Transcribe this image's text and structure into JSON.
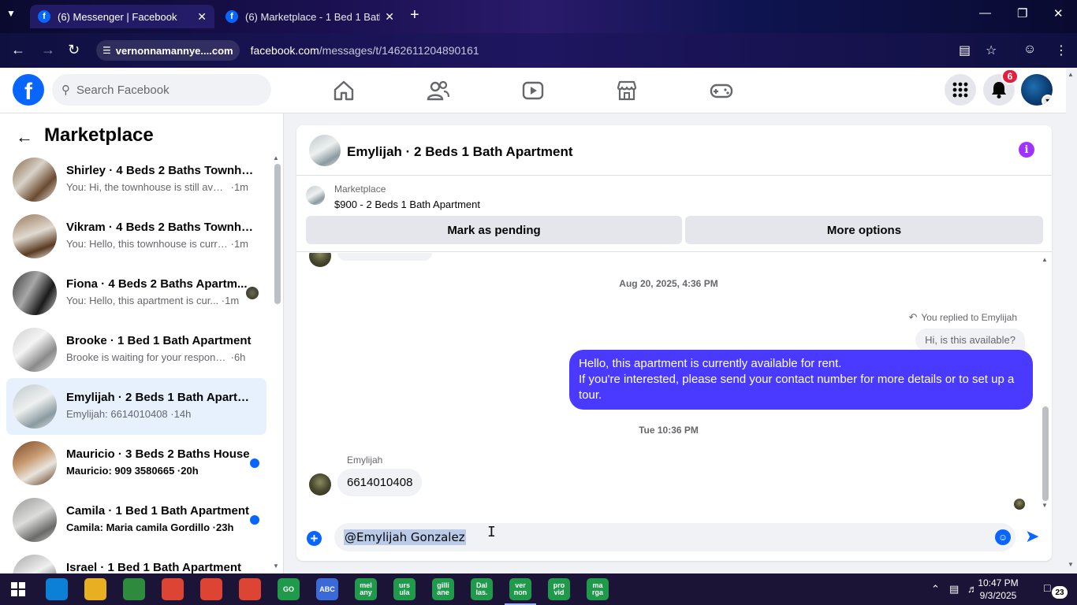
{
  "browser": {
    "tabs": [
      {
        "title": "(6) Messenger | Facebook",
        "active": true
      },
      {
        "title": "(6) Marketplace - 1 Bed 1 Bath Apartment",
        "active": false
      }
    ],
    "site_chip": "vernonnamannye....com",
    "url_host": "facebook.com",
    "url_path": "/messages/t/1462611204890161"
  },
  "fb": {
    "logo": "f",
    "search_placeholder": "Search Facebook",
    "notification_count": "6",
    "nav_icons": [
      "home-icon",
      "friends-icon",
      "video-icon",
      "marketplace-icon",
      "gaming-icon"
    ]
  },
  "sidebar": {
    "title": "Marketplace",
    "conversations": [
      {
        "name": "Shirley · 4 Beds 2 Baths Townho...",
        "snippet": "You: Hi, the townhouse is still avail...",
        "time": "1m",
        "unread": false
      },
      {
        "name": "Vikram · 4 Beds 2 Baths Townho...",
        "snippet": "You: Hello, this townhouse is curre...",
        "time": "1m",
        "unread": false
      },
      {
        "name": "Fiona · 4 Beds 2 Baths Apartm...",
        "snippet": "You: Hello, this apartment is cur...",
        "time": "1m",
        "unread": false
      },
      {
        "name": "Brooke · 1 Bed 1 Bath Apartment",
        "snippet": "Brooke is waiting for your response.",
        "time": "6h",
        "unread": false
      },
      {
        "name": "Emylijah · 2 Beds 1 Bath Apartm...",
        "snippet": "Emylijah: 6614010408",
        "time": "14h",
        "unread": false,
        "selected": true
      },
      {
        "name": "Mauricio · 3 Beds 2 Baths House",
        "snippet": "Mauricio: 909 3580665",
        "time": "20h",
        "unread": true
      },
      {
        "name": "Camila · 1 Bed 1 Bath Apartment",
        "snippet": "Camila: Maria camila Gordillo",
        "time": "23h",
        "unread": true
      },
      {
        "name": "Israel · 1 Bed 1 Bath Apartment",
        "snippet": "",
        "time": "",
        "unread": false
      }
    ]
  },
  "chat": {
    "title": "Emylijah · 2 Beds 1 Bath Apartment",
    "marketplace_label": "Marketplace",
    "listing": "$900 - 2 Beds 1 Bath Apartment",
    "mark_pending": "Mark as pending",
    "more_options": "More options",
    "timestamp_1": "Aug 20, 2025, 4:36 PM",
    "replied_label": "You replied to Emylijah",
    "quoted_text": "Hi, is this available?",
    "outgoing_line_1": "Hello, this apartment is currently available for rent.",
    "outgoing_line_2": "If you're interested, please send your contact number for more details or to set up a tour.",
    "timestamp_2": "Tue 10:36 PM",
    "sender_name": "Emylijah",
    "incoming_text": "6614010408",
    "composer_value": "@Emylijah Gonzalez"
  },
  "taskbar": {
    "apps": [
      {
        "label": "",
        "color": "#0c7fd6",
        "icon": "edge-icon"
      },
      {
        "label": "",
        "color": "#e8b020",
        "icon": "folder-icon"
      },
      {
        "label": "",
        "color": "#2e8b3e",
        "icon": "spreadsheet-icon"
      },
      {
        "label": "",
        "color": "#dd4433",
        "icon": "chrome-icon"
      },
      {
        "label": "",
        "color": "#dd4433",
        "icon": "chrome-h-icon"
      },
      {
        "label": "",
        "color": "#dd4433",
        "icon": "chrome-m-icon"
      },
      {
        "label": "GO",
        "color": "#1e9a4a",
        "icon": "go-icon"
      },
      {
        "label": "ABC",
        "color": "#3a6ad8",
        "icon": "abc-icon"
      },
      {
        "label": "mel any",
        "color": "#1e9a4a",
        "icon": "melany-icon"
      },
      {
        "label": "urs ula",
        "color": "#1e9a4a",
        "icon": "ursula-icon"
      },
      {
        "label": "gilli ane",
        "color": "#1e9a4a",
        "icon": "gilliane-icon"
      },
      {
        "label": "Dal las.",
        "color": "#1e9a4a",
        "icon": "dallas-icon"
      },
      {
        "label": "ver non",
        "color": "#1e9a4a",
        "icon": "vernon-icon",
        "active": true
      },
      {
        "label": "pro vid",
        "color": "#1e9a4a",
        "icon": "provid-icon"
      },
      {
        "label": "ma rga",
        "color": "#1e9a4a",
        "icon": "marga-icon"
      }
    ],
    "time": "10:47 PM",
    "date": "9/3/2025",
    "notification_count": "23"
  }
}
